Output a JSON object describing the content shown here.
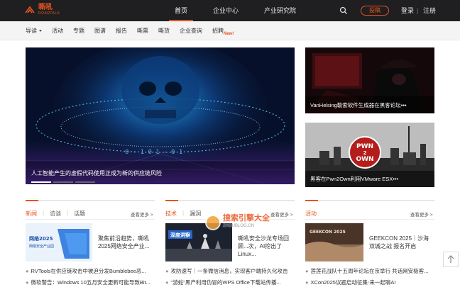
{
  "header": {
    "logo_text": "嘶吼",
    "logo_sub": "ROARTALK",
    "nav": [
      "首页",
      "企业中心",
      "产业研究院"
    ],
    "contribute": "投稿",
    "login": "登录",
    "separator": "|",
    "register": "注册"
  },
  "subnav": {
    "items": [
      "导读",
      "活动",
      "专题",
      "图谱",
      "报告",
      "嘶票",
      "嘶货",
      "企业查询",
      "招聘"
    ],
    "new_badge": "New!"
  },
  "hero": {
    "caption": "人工智能产生的虚假代码使用正成为新的供应链风险"
  },
  "side_cards": [
    {
      "caption": "VanHelsing勒索软件生成器在黑客论坛•••"
    },
    {
      "caption": "黑客在Pwn2Own利用VMware ESX•••"
    }
  ],
  "sections": [
    {
      "tabs": [
        "新闻",
        "访谈",
        "话题"
      ],
      "more": "查看更多 >",
      "thumb_text": "网络2025\n网络安全产业园",
      "feature": "聚焦前沿趋势，嘶吼2025网络安全产业...",
      "list": [
        "RVTools在供应链攻击中被迫分发Bumblebee恶...",
        "微软警告：Windows 10五月安全更新可能导致Bit..."
      ]
    },
    {
      "tabs": [
        "技术",
        "漏洞"
      ],
      "more": "查看更多 >",
      "thumb_text": "深度洞察",
      "feature": "嘶吼安全沙龙专场回顾...次，AI挖出了Linux...",
      "list": [
        "攻防速写｜一条微信消息，实现客户端持久化攻击",
        "\"游蛇\"黑产利用伪冒的WPS Office下载站传播..."
      ]
    },
    {
      "tabs": [
        "活动"
      ],
      "more": "查看更多 >",
      "thumb_text": "GEEKCON 2025",
      "feature": "GEEKCON 2025｜沙海双城之战 报名开启",
      "list": [
        "莲莲花战队十五周年论坛在京举行 共话网安极客...",
        "XCon2025议题启动征集‧来一起聊AI"
      ]
    }
  ],
  "watermark": {
    "text": "搜索引擎大全",
    "sub": "ZHOUBLOG.CN"
  },
  "colors": {
    "accent": "#e8541e",
    "topbar": "#1f1f21"
  }
}
